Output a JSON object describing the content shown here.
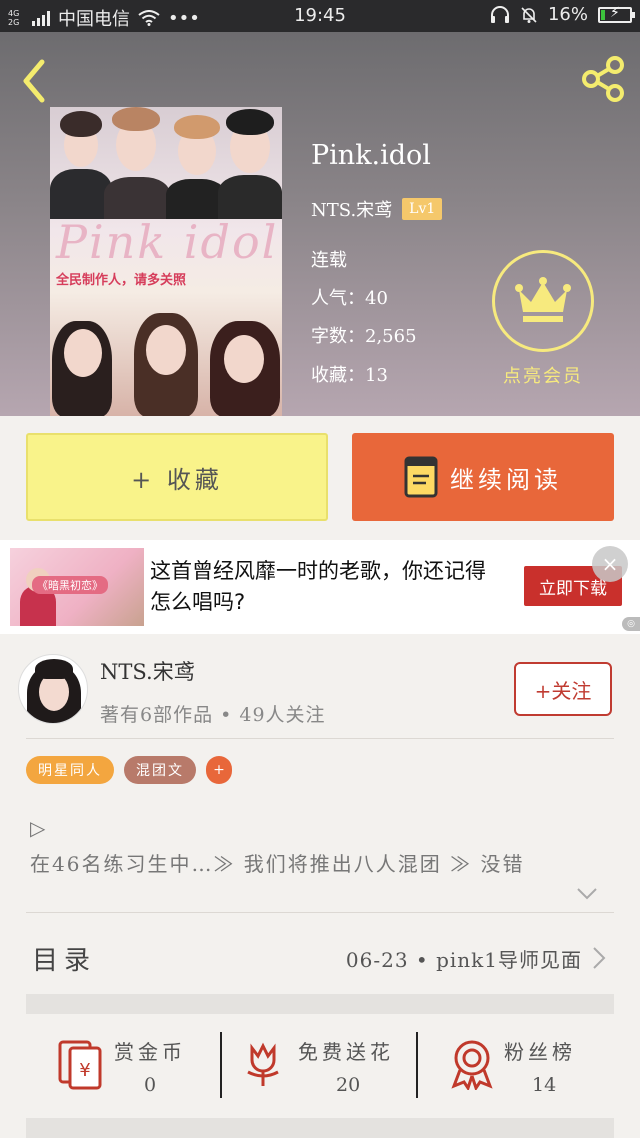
{
  "status_bar": {
    "network": "4G\n2G",
    "carrier": "中国电信",
    "more": "•••",
    "time": "19:45",
    "battery_percent": "16%",
    "battery_level": 0.16
  },
  "book": {
    "title": "Pink.idol",
    "author": "NTS.宋鸢",
    "level": "Lv1",
    "status": "连载",
    "popularity": "人气：40",
    "word_count": "字数：2,565",
    "favorites": "收藏：13",
    "cover_title": "Pink idol",
    "cover_subtitle": "全民制作人，请多关照"
  },
  "vip": {
    "label": "点亮会员"
  },
  "actions": {
    "collect": "+ 收藏",
    "continue_reading": "继续阅读"
  },
  "ad": {
    "text": "这首曾经风靡一时的老歌，你还记得怎么唱吗?",
    "button": "立即下载",
    "close": "×",
    "image_tag": "《暗黑初恋》"
  },
  "author_section": {
    "name": "NTS.宋鸢",
    "stats": "著有6部作品 • 49人关注",
    "follow": "+关注"
  },
  "tags": [
    {
      "label": "明星同人",
      "color": "#f3a63f"
    },
    {
      "label": "混团文",
      "color": "#b87a6a"
    },
    {
      "label": "+",
      "color": "#e8673a"
    }
  ],
  "synopsis": {
    "mark": "▷",
    "text": "在46名练习生中…≫    我们将推出八人混团    ≫    没错"
  },
  "toc": {
    "label": "目录",
    "latest": "06-23  •  pink1导师见面"
  },
  "stats": [
    {
      "label": "赏金币",
      "value": "0"
    },
    {
      "label": "免费送花",
      "value": "20"
    },
    {
      "label": "粉丝榜",
      "value": "14"
    }
  ],
  "colors": {
    "accent_orange": "#e8673a",
    "collect_yellow": "#f9f38a",
    "vip_gold": "#f7ea7e",
    "follow_red": "#c03b31",
    "icon_red": "#c0392b"
  }
}
